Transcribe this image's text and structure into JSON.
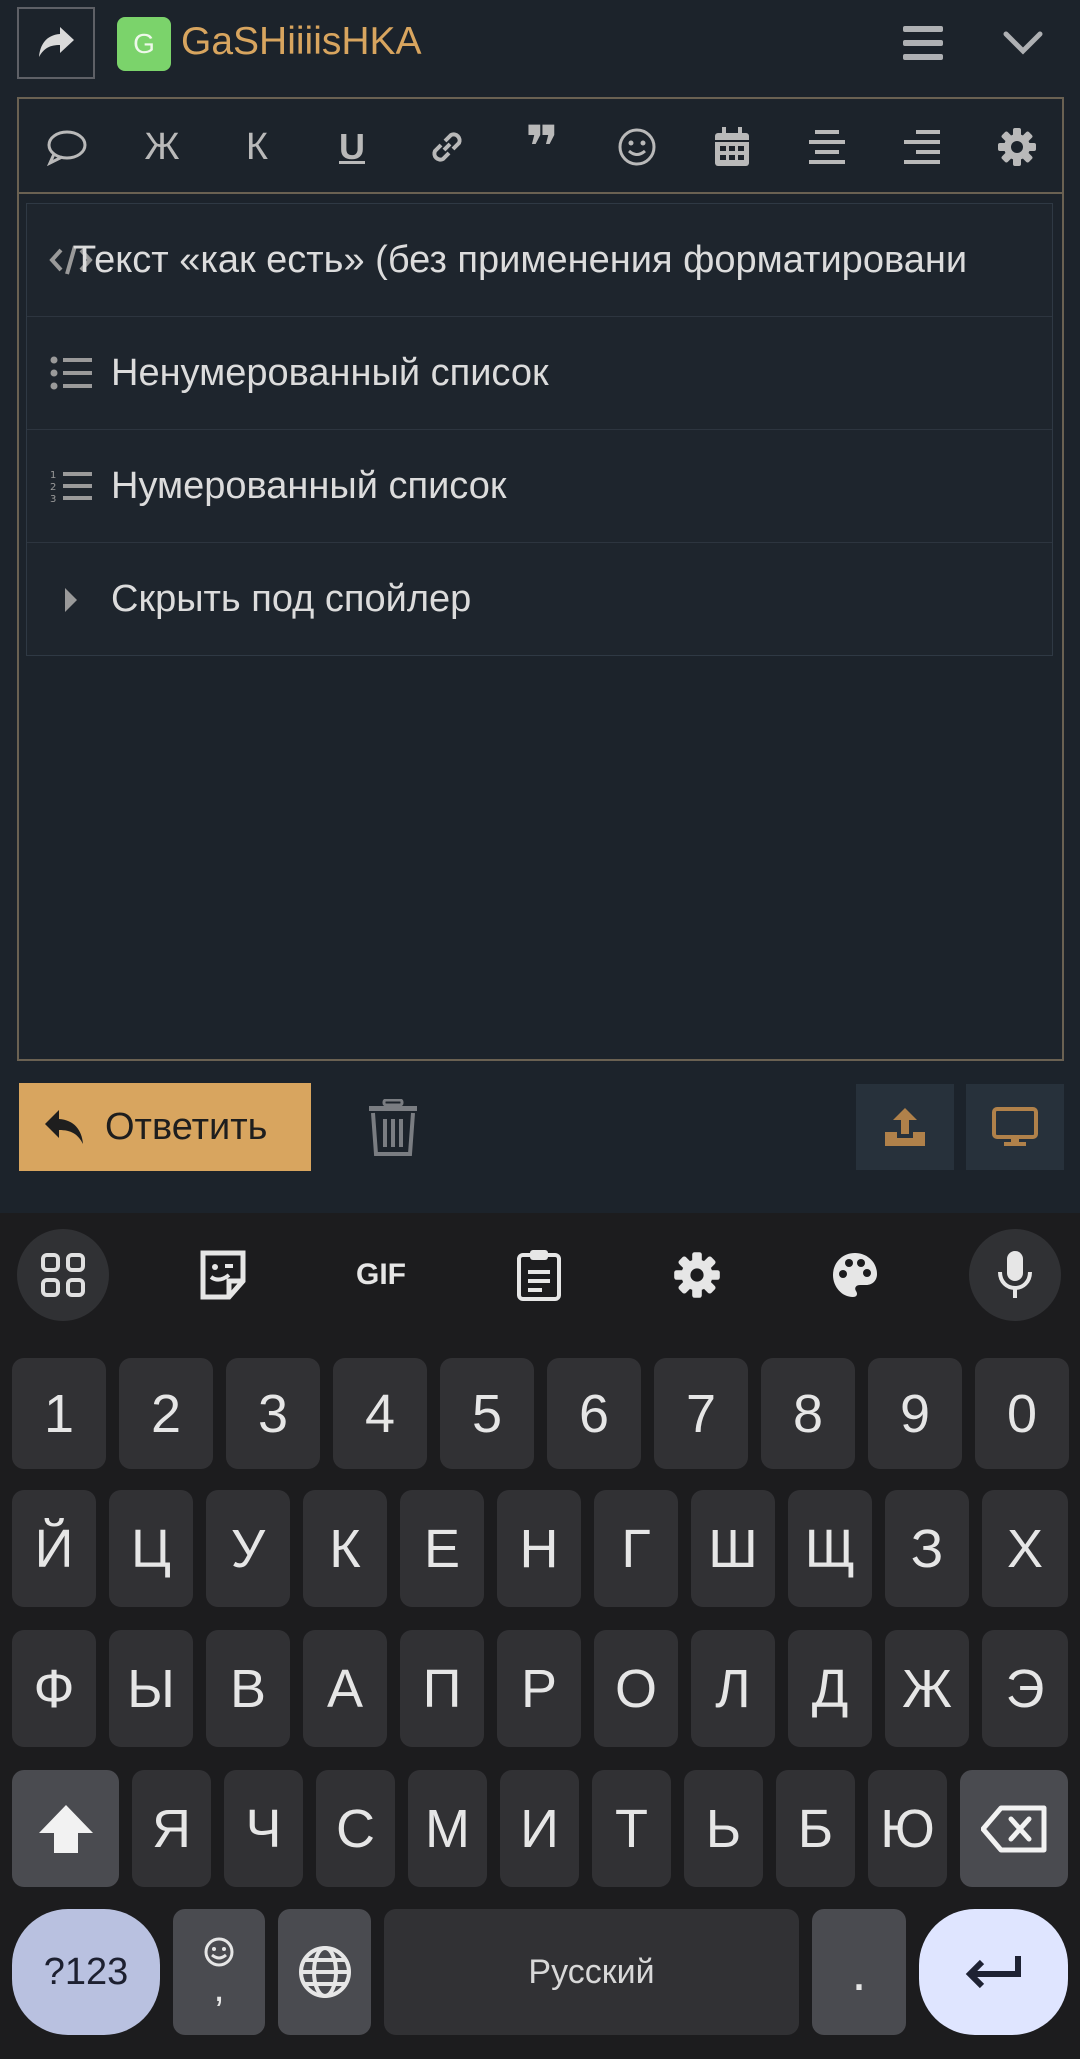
{
  "header": {
    "avatar_letter": "G",
    "username": "GaSHiiiisHKA"
  },
  "editor": {
    "toolbar": [
      {
        "name": "speech-bubble-icon",
        "label": ""
      },
      {
        "name": "bold-icon",
        "label": "Ж"
      },
      {
        "name": "italic-icon",
        "label": "К"
      },
      {
        "name": "underline-icon",
        "label": "U"
      },
      {
        "name": "link-icon",
        "label": ""
      },
      {
        "name": "quote-icon",
        "label": "❞"
      },
      {
        "name": "smiley-icon",
        "label": ""
      },
      {
        "name": "calendar-icon",
        "label": ""
      },
      {
        "name": "align-center-icon",
        "label": ""
      },
      {
        "name": "align-right-icon",
        "label": ""
      },
      {
        "name": "gear-icon",
        "label": ""
      }
    ],
    "dropdown": [
      {
        "icon": "code-icon",
        "label": "Текст «как есть» (без применения форматировани"
      },
      {
        "icon": "bulleted-list-icon",
        "label": "Ненумерованный список"
      },
      {
        "icon": "numbered-list-icon",
        "label": "Нумерованный список"
      },
      {
        "icon": "caret-right-icon",
        "label": "Скрыть под спойлер"
      }
    ]
  },
  "actions": {
    "reply_label": "Ответить"
  },
  "colors": {
    "accent": "#d8a55f",
    "background": "#1c232b",
    "avatar": "#7bd36b"
  },
  "keyboard": {
    "toolbar": [
      "apps-grid-icon",
      "sticker-icon",
      "GIF",
      "clipboard-icon",
      "gear-icon",
      "palette-icon",
      "microphone-icon"
    ],
    "row_numbers": [
      "1",
      "2",
      "3",
      "4",
      "5",
      "6",
      "7",
      "8",
      "9",
      "0"
    ],
    "row1": [
      "Й",
      "Ц",
      "У",
      "К",
      "Е",
      "Н",
      "Г",
      "Ш",
      "Щ",
      "З",
      "Х"
    ],
    "row2": [
      "Ф",
      "Ы",
      "В",
      "А",
      "П",
      "Р",
      "О",
      "Л",
      "Д",
      "Ж",
      "Э"
    ],
    "row3": [
      "Я",
      "Ч",
      "С",
      "М",
      "И",
      "Т",
      "Ь",
      "Б",
      "Ю"
    ],
    "sym_label": "?123",
    "comma_label": ",",
    "space_label": "Русский",
    "period_label": "."
  }
}
